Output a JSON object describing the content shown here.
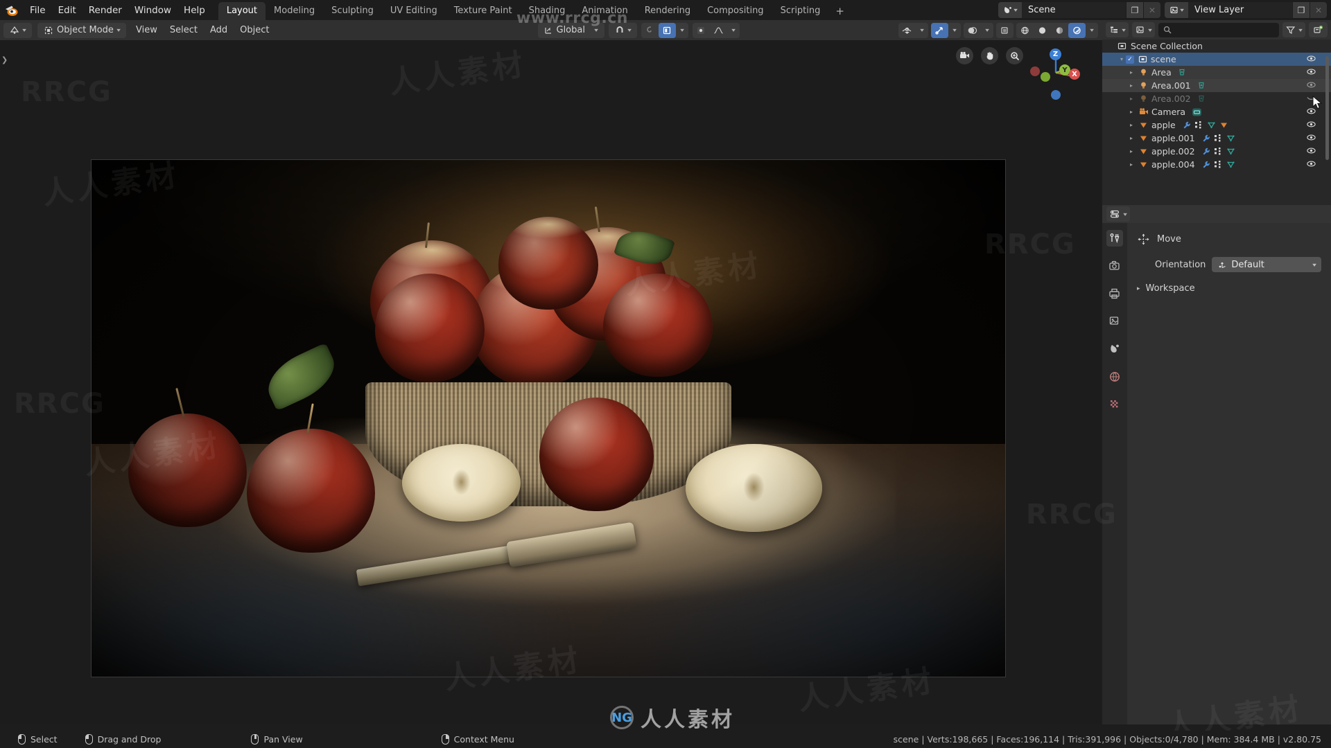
{
  "app": {
    "name": "Blender",
    "version_label": "v2.80.75"
  },
  "topbar": {
    "logo_icon": "blender-logo-icon",
    "menus": [
      "File",
      "Edit",
      "Render",
      "Window",
      "Help"
    ],
    "workspace_tabs": [
      {
        "label": "Layout",
        "active": true
      },
      {
        "label": "Modeling",
        "active": false
      },
      {
        "label": "Sculpting",
        "active": false
      },
      {
        "label": "UV Editing",
        "active": false
      },
      {
        "label": "Texture Paint",
        "active": false
      },
      {
        "label": "Shading",
        "active": false
      },
      {
        "label": "Animation",
        "active": false
      },
      {
        "label": "Rendering",
        "active": false
      },
      {
        "label": "Compositing",
        "active": false
      },
      {
        "label": "Scripting",
        "active": false
      }
    ],
    "add_workspace_label": "+",
    "scene": {
      "icon": "scene-icon",
      "name": "Scene",
      "copy_icon": "new-copy-icon",
      "unlink_icon": "unlink-x-icon"
    },
    "view_layer": {
      "icon": "view-layer-icon",
      "name": "View Layer",
      "copy_icon": "new-copy-icon",
      "unlink_icon": "unlink-x-icon"
    }
  },
  "viewport_header": {
    "editor_type_icon": "editor-type-3dview-icon",
    "mode": {
      "icon": "object-mode-icon",
      "label": "Object Mode"
    },
    "menus": [
      "View",
      "Select",
      "Add",
      "Object"
    ],
    "transform_orientation": {
      "icon": "orientation-icon",
      "label": "Global"
    },
    "snap_icon": "magnet-icon",
    "proportional_icons": [
      "proportional-edit-icon",
      "proportional-edit-object-icon",
      "falloff-curve-icon"
    ],
    "right_controls": [
      "visibility-eye-icon",
      "gizmo-icon",
      "overlays-icon",
      "xray-toggle-icon",
      "shading-wireframe-icon",
      "shading-solid-icon",
      "shading-material-icon",
      "shading-rendered-icon"
    ]
  },
  "viewport": {
    "collapse_arrow": "toolbar-expand-arrow-icon",
    "nav_widgets": [
      "camera-view-icon",
      "pan-hand-icon",
      "zoom-magnifier-icon"
    ],
    "gizmo_axes": [
      {
        "label": "Z",
        "color": "#3b7fd4"
      },
      {
        "label": "Y",
        "color": "#8fbc3f"
      },
      {
        "label": "X",
        "color": "#d9504e"
      }
    ],
    "render_preview_alt": "rendered still life of red apples in a burlap-lined basket with cut apple halves and a knife on a wooden table"
  },
  "outliner": {
    "header": {
      "editor_type_icon": "editor-type-outliner-icon",
      "display_mode_icon": "view-layer-display-icon",
      "search_icon": "search-icon",
      "search_value": "",
      "filter_icon": "filter-funnel-icon",
      "new_collection_icon": "new-collection-icon"
    },
    "root": {
      "label": "Scene Collection",
      "icon": "collection-icon"
    },
    "items": [
      {
        "label": "scene",
        "icon": "collection-icon",
        "state": "selected",
        "checkbox": true,
        "has_disclosure": true,
        "expanded": true,
        "indent": 1,
        "extra_icons": [],
        "visible": true
      },
      {
        "label": "Area",
        "icon": "light-icon",
        "state": "hover-row",
        "checkbox": false,
        "has_disclosure": true,
        "expanded": false,
        "indent": 2,
        "extra_icons": [
          "light-data-icon"
        ],
        "visible": true
      },
      {
        "label": "Area.001",
        "icon": "light-icon",
        "state": "highlight",
        "checkbox": false,
        "has_disclosure": true,
        "expanded": false,
        "indent": 2,
        "extra_icons": [
          "light-data-icon"
        ],
        "visible": true
      },
      {
        "label": "Area.002",
        "icon": "light-icon",
        "state": "muted",
        "checkbox": false,
        "has_disclosure": true,
        "expanded": false,
        "indent": 2,
        "extra_icons": [
          "light-data-icon"
        ],
        "visible": false
      },
      {
        "label": "Camera",
        "icon": "camera-icon",
        "state": "normal",
        "checkbox": false,
        "has_disclosure": true,
        "expanded": false,
        "indent": 2,
        "extra_icons": [
          "camera-data-icon"
        ],
        "visible": true
      },
      {
        "label": "apple",
        "icon": "mesh-object-icon",
        "state": "normal",
        "checkbox": false,
        "has_disclosure": true,
        "expanded": false,
        "indent": 2,
        "extra_icons": [
          "modifier-wrench-icon",
          "particles-icon",
          "mesh-data-icon",
          "material-icon"
        ],
        "visible": true
      },
      {
        "label": "apple.001",
        "icon": "mesh-object-icon",
        "state": "normal",
        "checkbox": false,
        "has_disclosure": true,
        "expanded": false,
        "indent": 2,
        "extra_icons": [
          "modifier-wrench-icon",
          "particles-icon",
          "mesh-data-icon"
        ],
        "visible": true
      },
      {
        "label": "apple.002",
        "icon": "mesh-object-icon",
        "state": "normal",
        "checkbox": false,
        "has_disclosure": true,
        "expanded": false,
        "indent": 2,
        "extra_icons": [
          "modifier-wrench-icon",
          "particles-icon",
          "mesh-data-icon"
        ],
        "visible": true
      },
      {
        "label": "apple.004",
        "icon": "mesh-object-icon",
        "state": "normal",
        "checkbox": false,
        "has_disclosure": true,
        "expanded": false,
        "indent": 2,
        "extra_icons": [
          "modifier-wrench-icon",
          "particles-icon",
          "mesh-data-icon"
        ],
        "visible": true
      }
    ]
  },
  "properties": {
    "header_icon": "properties-editor-icon",
    "tabs": [
      {
        "icon": "tool-icon",
        "name": "tool",
        "active": true
      },
      {
        "icon": "render-camera-icon",
        "name": "render",
        "active": false
      },
      {
        "icon": "output-printer-icon",
        "name": "output",
        "active": false
      },
      {
        "icon": "view-layer-icon",
        "name": "view-layer",
        "active": false
      },
      {
        "icon": "scene-icon",
        "name": "scene",
        "active": false
      },
      {
        "icon": "world-icon",
        "name": "world",
        "active": false
      },
      {
        "icon": "texture-checker-icon",
        "name": "texture",
        "active": false
      }
    ],
    "active_tool": {
      "icon": "move-tool-icon",
      "label": "Move"
    },
    "orientation": {
      "label": "Orientation",
      "icon": "orientation-axes-icon",
      "value": "Default"
    },
    "workspace_panel": {
      "label": "Workspace",
      "collapsed": true
    }
  },
  "statusbar": {
    "hints": [
      {
        "icon": "mouse-left-icon",
        "label": "Select"
      },
      {
        "icon": "mouse-drag-icon",
        "label": "Drag and Drop"
      },
      {
        "icon": "mouse-middle-icon",
        "label": "Pan View"
      },
      {
        "icon": "mouse-right-icon",
        "label": "Context Menu"
      }
    ],
    "stats": "scene | Verts:198,665 | Faces:196,114 | Tris:391,996 | Objects:0/4,780 | Mem: 384.4 MB | v2.80.75"
  },
  "watermarks": {
    "url": "www.rrcg.cn",
    "logo_text": "人人素材",
    "logo_mark": "NG",
    "tiles_cn": "人人素材",
    "tiles_rr": "RRCG"
  },
  "colors": {
    "accent_blue": "#4772b3",
    "selection_blue": "#3b5a80",
    "panel_bg": "#303030",
    "editor_bg": "#282828",
    "window_bg": "#1d1d1d",
    "axis_x": "#d9504e",
    "axis_y": "#8fbc3f",
    "axis_z": "#3b7fd4"
  }
}
